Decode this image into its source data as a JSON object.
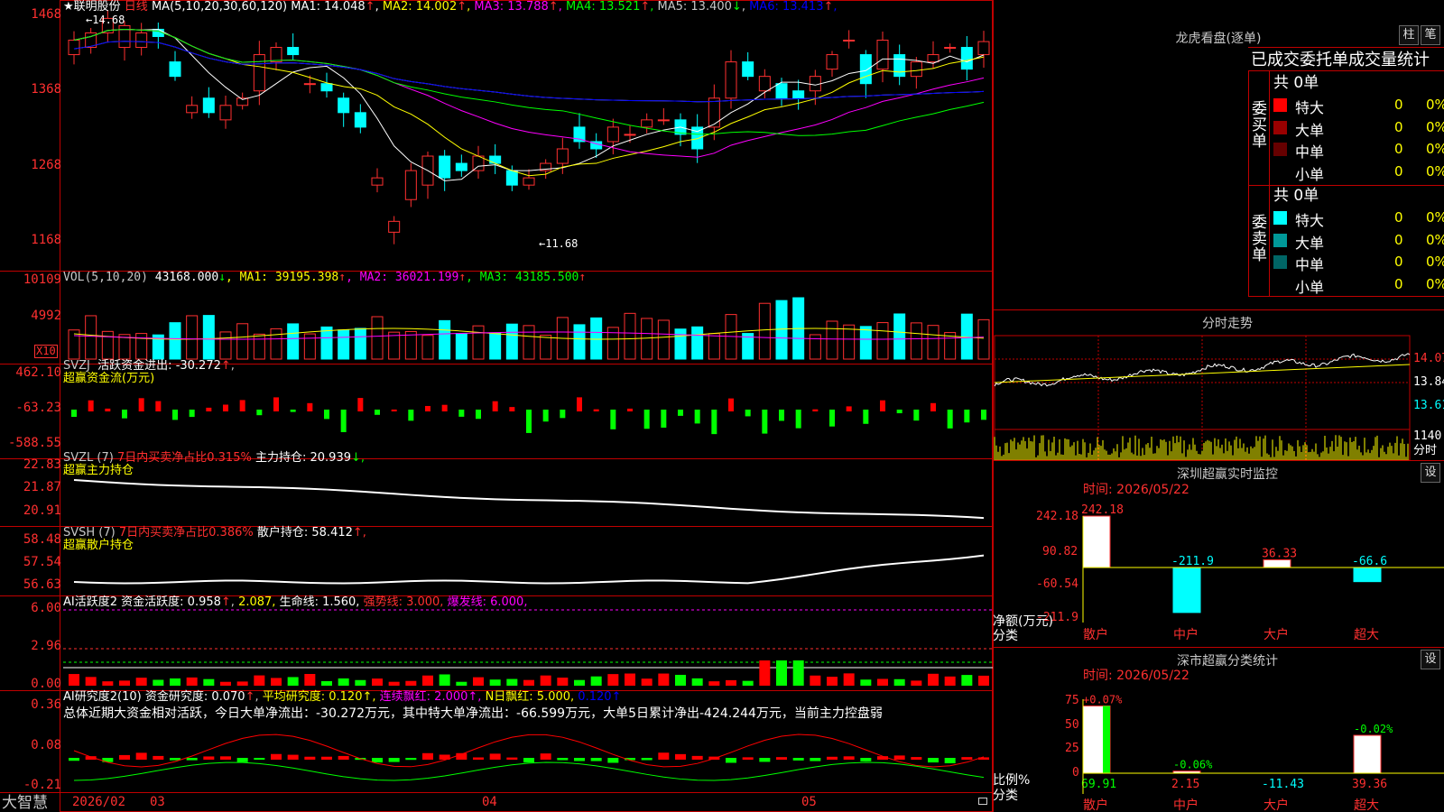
{
  "header": {
    "stock_name": "★联明股份",
    "period": "日线",
    "ma_title": "MA(5,10,20,30,60,120)",
    "ma": [
      {
        "label": "MA1:",
        "value": "14.048",
        "arrow": "↑",
        "color": "#ffffff"
      },
      {
        "label": "MA2:",
        "value": "14.002",
        "arrow": "↑",
        "color": "#ffff00"
      },
      {
        "label": "MA3:",
        "value": "13.788",
        "arrow": "↑",
        "color": "#ff00ff"
      },
      {
        "label": "MA4:",
        "value": "13.521",
        "arrow": "↑",
        "color": "#00ff00"
      },
      {
        "label": "MA5:",
        "value": "13.400",
        "arrow": "↓",
        "color": "#c8c8c8"
      },
      {
        "label": "MA6:",
        "value": "13.413",
        "arrow": "↑",
        "color": "#0000ff"
      }
    ],
    "high_mark": "14.68",
    "low_mark": "11.68"
  },
  "price_axis": [
    "1468",
    "1368",
    "1268",
    "1168"
  ],
  "vol": {
    "title": "VOL(5,10,20)",
    "value": "43168.000",
    "arrow": "↓",
    "ma": [
      {
        "label": "MA1:",
        "value": "39195.398",
        "arrow": "↑",
        "color": "#ffff00"
      },
      {
        "label": "MA2:",
        "value": "36021.199",
        "arrow": "↑",
        "color": "#ff00ff"
      },
      {
        "label": "MA3:",
        "value": "43185.500",
        "arrow": "↑",
        "color": "#00ff00"
      }
    ],
    "axis": [
      "10109",
      "4992"
    ],
    "unit": "X10"
  },
  "svzj": {
    "title": "SVZJ",
    "label": "活跃资金进出:",
    "value": "-30.272",
    "arrow": "↑",
    "sub": "超赢资金流(万元)",
    "axis": [
      "462.10",
      "-63.23",
      "-588.55"
    ]
  },
  "svzl": {
    "title": "SVZL (7)",
    "label1": "7日内买卖净占比0.315%",
    "label2": "主力持仓:",
    "value": "20.939",
    "arrow": "↓,",
    "sub": "超赢主力持仓",
    "axis": [
      "22.83",
      "21.87",
      "20.91"
    ]
  },
  "svsh": {
    "title": "SVSH (7)",
    "label1": "7日内买卖净占比0.386%",
    "label2": "散户持仓:",
    "value": "58.412",
    "arrow": "↑,",
    "sub": "超赢散户持仓",
    "axis": [
      "58.48",
      "57.54",
      "56.63"
    ]
  },
  "ai_active": {
    "title": "AI活跃度2",
    "label": "资金活跃度:",
    "value": "0.958",
    "arrow": "↑",
    "extra": "2.087,",
    "life": "生命线: 1.560,",
    "strong": "强势线: 3.000,",
    "burst": "爆发线: 6.000,",
    "axis": [
      "6.00",
      "2.96",
      "0.00"
    ]
  },
  "ai_research": {
    "title": "AI研究度2(10)",
    "label": "资金研究度:",
    "value": "0.070",
    "arrow": "↑",
    "avg": "平均研究度: 0.120↑,",
    "cont": "连续飘红: 2.000↑,",
    "nday": "N日飘红: 5.000,",
    "last": "0.120↑",
    "summary": "总体近期大资金相对活跃，今日大单净流出：-30.272万元，其中特大单净流出：-66.599万元，大单5日累计净出-424.244万元，当前主力控盘弱",
    "axis": [
      "0.36",
      "0.08",
      "-0.21"
    ]
  },
  "bottom_bar": {
    "brand": "大智慧",
    "dates": [
      "2026/02",
      "03",
      "04",
      "05"
    ]
  },
  "dragon_tiger": {
    "title": "龙虎看盘(逐单)",
    "btn_bar": "柱",
    "btn_pen": "笔",
    "tabs": "已成交委托单成交量统计",
    "buy_side": "委买单",
    "sell_side": "委卖单",
    "buy_total": "共 0单",
    "sell_total": "共 0单",
    "buy_rows": [
      {
        "label": "特大",
        "count": "0",
        "pct": "0%",
        "color": "#ff0000"
      },
      {
        "label": "大单",
        "count": "0",
        "pct": "0%",
        "color": "#990000"
      },
      {
        "label": "中单",
        "count": "0",
        "pct": "0%",
        "color": "#660000"
      },
      {
        "label": "小单",
        "count": "0",
        "pct": "0%",
        "color": "#000000"
      }
    ],
    "sell_rows": [
      {
        "label": "特大",
        "count": "0",
        "pct": "0%",
        "color": "#00ffff"
      },
      {
        "label": "大单",
        "count": "0",
        "pct": "0%",
        "color": "#009999"
      },
      {
        "label": "中单",
        "count": "0",
        "pct": "0%",
        "color": "#006666"
      },
      {
        "label": "小单",
        "count": "0",
        "pct": "0%",
        "color": "#000000"
      }
    ]
  },
  "intraday": {
    "title": "分时走势",
    "axis": [
      "14.07",
      "13.84",
      "13.61"
    ],
    "vol_axis": "1140",
    "vol_label": "分时"
  },
  "sz_monitor": {
    "title": "深圳超赢实时监控",
    "btn": "设",
    "time_label": "时间: 2026/05/22",
    "axis": [
      "242.18",
      "90.82",
      "-60.54",
      "-211.9"
    ],
    "ylabel": "净额(万元)",
    "xlabel": "分类",
    "bars": [
      {
        "cat": "散户",
        "value": 242.18,
        "label": "242.18"
      },
      {
        "cat": "中户",
        "value": -211.9,
        "label": "-211.9"
      },
      {
        "cat": "大户",
        "value": 36.33,
        "label": "36.33"
      },
      {
        "cat": "超大",
        "value": -66.6,
        "label": "-66.6"
      }
    ]
  },
  "sz_class": {
    "title": "深市超赢分类统计",
    "btn": "设",
    "time_label": "时间: 2026/05/22",
    "axis": [
      "75",
      "50",
      "25",
      "0"
    ],
    "ylabel": "比例%",
    "xlabel": "分类",
    "bars": [
      {
        "cat": "散户",
        "value": 69.91,
        "label": "69.91",
        "delta": "+0.07%"
      },
      {
        "cat": "中户",
        "value": 2.15,
        "label": "2.15",
        "delta": "-0.06%"
      },
      {
        "cat": "大户",
        "value": -11.43,
        "label": "-11.43",
        "delta": ""
      },
      {
        "cat": "超大",
        "value": 39.36,
        "label": "39.36",
        "delta": "-0.02%"
      }
    ]
  },
  "chart_data": {
    "type": "candlestick",
    "series": {
      "close": [
        14.4,
        14.5,
        14.7,
        14.6,
        14.5,
        14.45,
        13.9,
        13.5,
        13.4,
        13.5,
        13.6,
        14.2,
        14.3,
        14.2,
        13.8,
        13.7,
        13.4,
        13.2,
        12.5,
        11.9,
        12.6,
        12.8,
        12.5,
        12.6,
        12.8,
        12.7,
        12.4,
        12.5,
        12.7,
        12.9,
        13.0,
        12.9,
        13.2,
        13.1,
        13.3,
        13.3,
        13.1,
        12.9,
        13.6,
        14.1,
        13.9,
        13.9,
        13.6,
        13.6,
        13.9,
        14.2,
        14.4,
        13.8,
        14.4,
        13.9,
        14.1,
        14.2,
        14.3,
        14.0,
        14.38
      ],
      "open": [
        14.2,
        14.3,
        14.5,
        14.3,
        14.3,
        14.55,
        14.1,
        13.4,
        13.6,
        13.3,
        13.5,
        13.7,
        14.1,
        14.3,
        13.8,
        13.8,
        13.6,
        13.4,
        12.4,
        11.75,
        12.2,
        12.4,
        12.8,
        12.7,
        12.6,
        12.8,
        12.6,
        12.4,
        12.6,
        12.7,
        13.2,
        13.0,
        13.0,
        13.1,
        13.2,
        13.3,
        13.3,
        13.2,
        13.2,
        13.6,
        14.1,
        13.7,
        13.8,
        13.7,
        13.7,
        14.0,
        14.4,
        14.2,
        14.0,
        14.2,
        13.9,
        14.1,
        14.3,
        14.3,
        14.2
      ]
    }
  }
}
